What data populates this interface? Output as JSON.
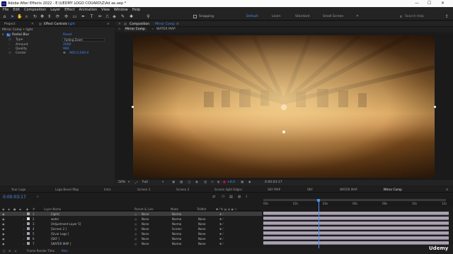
{
  "window": {
    "title": "Adobe After Effects 2022 - E:\\UEDMY LOGO COUARD\\Z\\Ad ae.aep *",
    "app_icon": "Ae",
    "minimize": "—",
    "maximize": "☐",
    "close": "✕"
  },
  "menu": [
    "File",
    "Edit",
    "Composition",
    "Layer",
    "Effect",
    "Animation",
    "View",
    "Window",
    "Help"
  ],
  "toolbar": {
    "snapping": "Snapping",
    "workspaces": [
      "Default",
      "Learn",
      "Standard",
      "Small Screen"
    ],
    "active_workspace": "Default",
    "search_placeholder": "Search Help"
  },
  "left_panel": {
    "tabs": [
      "Project",
      "Effect Controls"
    ],
    "effect_controls_layer": "light",
    "comp_path": "Mirror Comp • light",
    "effect": {
      "name": "Radial Blur",
      "reset": "Reset",
      "props": [
        {
          "label": "Type",
          "value": "Fading Zoom"
        },
        {
          "label": "Amount",
          "value": "2000"
        },
        {
          "label": "Quality",
          "value": "960"
        },
        {
          "label": "Center",
          "value": "960.0,540.0"
        }
      ]
    }
  },
  "comp_panel": {
    "title_prefix": "Composition",
    "title_comp": "Mirror Comp",
    "subtabs": [
      "Mirror Comp",
      "WATER MAP"
    ],
    "zoom": "50%",
    "resolution": "Full",
    "exposure": "+0.0",
    "timecode": "0:00:03:17"
  },
  "timeline": {
    "tabs": [
      "Your Logo",
      "Logo Bevel Map",
      "Intro",
      "Screen 1",
      "Screen 2",
      "Screen light Edges",
      "SKY MAP",
      "SKY",
      "WATER MAP",
      "Mirror Comp"
    ],
    "active_tab": "Mirror Comp",
    "timecode": "0:00:03:17",
    "search_placeholder": "⌕",
    "columns": {
      "layer_name": "Layer Name",
      "parent": "Parent & Link",
      "mode": "Mode",
      "trkmat": "TrkMat"
    },
    "layers": [
      {
        "num": "1",
        "name": "[light]",
        "parent": "None",
        "mode": "Norma",
        "trkmat": "",
        "color": "#a7a1b1",
        "selected": true
      },
      {
        "num": "2",
        "name": "water",
        "parent": "None",
        "mode": "Norma",
        "trkmat": "None",
        "color": "#e6e6e6",
        "selected": false
      },
      {
        "num": "3",
        "name": "[Adjustment Layer 5]",
        "parent": "None",
        "mode": "Norma",
        "trkmat": "None",
        "color": "#a7a1b1",
        "selected": false
      },
      {
        "num": "4",
        "name": "[Screen 2 ]",
        "parent": "None",
        "mode": "Screen",
        "trkmat": "None",
        "color": "#a7a1b1",
        "selected": false
      },
      {
        "num": "5",
        "name": "[Sivar Logo ]",
        "parent": "None",
        "mode": "Norma",
        "trkmat": "None",
        "color": "#a7a1b1",
        "selected": false
      },
      {
        "num": "6",
        "name": "[SKY ]",
        "parent": "None",
        "mode": "Norma",
        "trkmat": "None",
        "color": "#a7a1b1",
        "selected": false
      },
      {
        "num": "7",
        "name": "[WATER MAP ]",
        "parent": "None",
        "mode": "Norma",
        "trkmat": "None",
        "color": "#a7a1b1",
        "selected": false
      }
    ],
    "ruler": [
      "00s",
      "02s",
      "04s",
      "06s",
      "08s",
      "10s",
      "12s"
    ],
    "playhead_seconds": 3.7,
    "frame_render_label": "Frame Render Time",
    "frame_render_value": "9ms",
    "toggle_label": "Toggle Switches / Modes"
  },
  "watermark": "Udemy",
  "colors": {
    "accent": "#3f8cf5",
    "bg": "#232323",
    "layer_bar": "#a7a1b1"
  }
}
